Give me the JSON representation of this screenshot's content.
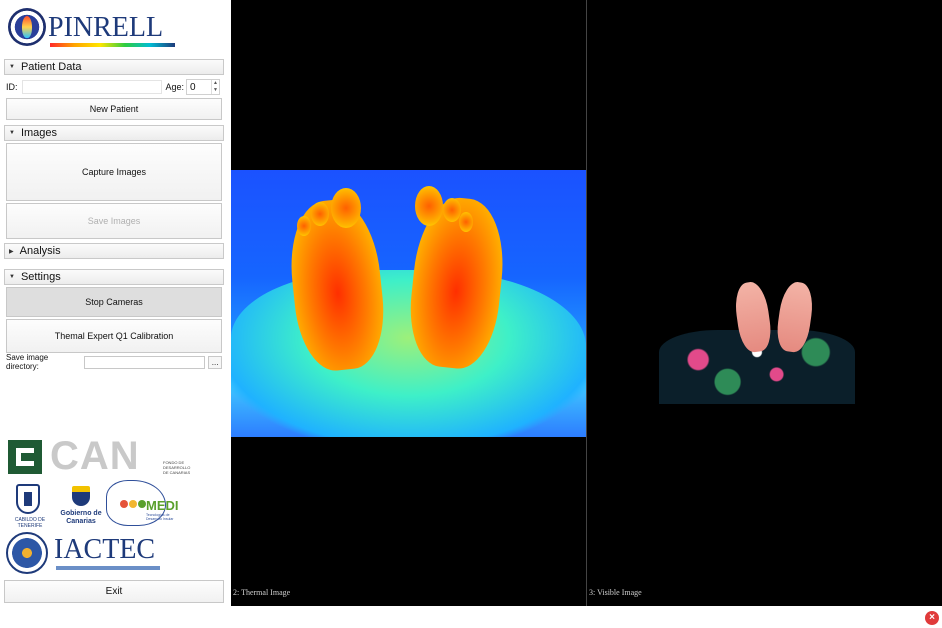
{
  "app": {
    "logo_text": "PINRELL"
  },
  "patient_section": {
    "title": "Patient Data",
    "id_label": "ID:",
    "id_value": "",
    "age_label": "Age:",
    "age_value": "0",
    "new_patient_label": "New Patient"
  },
  "images_section": {
    "title": "Images",
    "capture_label": "Capture Images",
    "save_label": "Save Images"
  },
  "analysis_section": {
    "title": "Analysis"
  },
  "settings_section": {
    "title": "Settings",
    "stop_cameras_label": "Stop Cameras",
    "calibration_label": "Themal Expert Q1 Calibration",
    "save_dir_label": "Save image directory:",
    "save_dir_value": "",
    "browse_label": "..."
  },
  "sponsors": {
    "can_text": "CAN",
    "can_small": "FONDO DE DESARROLLO DE CANARIAS",
    "cabildo_text": "CABILDO DE TENERIFE",
    "gobierno_text": "Gobierno de Canarias",
    "medi_text": "MEDI",
    "medi_sub": "Tecnologías de Desarrollo Insular",
    "iactec_text": "IACTEC"
  },
  "viewers": {
    "thermal_caption": "2: Thermal Image",
    "visible_caption": "3: Visible Image"
  },
  "footer": {
    "exit_label": "Exit",
    "close_icon": "×"
  }
}
